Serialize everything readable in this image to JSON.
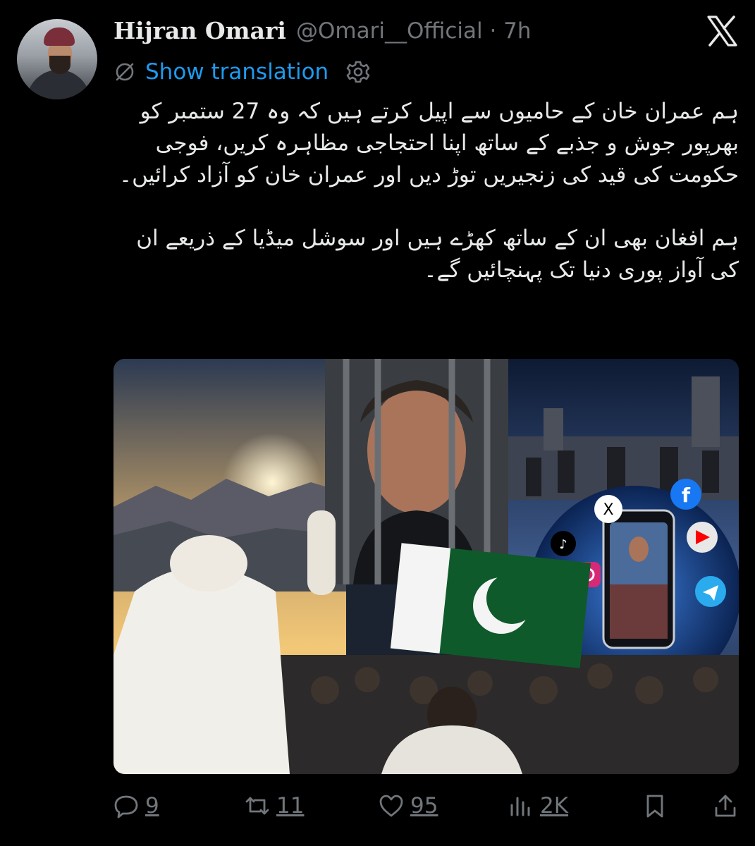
{
  "tweet": {
    "author_name": "Hijran Omari",
    "handle": "@Omari__Official",
    "separator": "·",
    "time": "7h",
    "show_translation": "Show translation",
    "text_paragraphs": [
      "ہم عمران خان کے حامیوں سے اپیل کرتے ہیں کہ وہ 27 ستمبر کو بھرپور جوش و جذبے کے ساتھ اپنا احتجاجی مظاہرہ کریں، فوجی حکومت کی قید کی زنجیریں توڑ دیں اور عمران خان کو آزاد کرائیں۔",
      "ہم افغان بھی ان کے ساتھ کھڑے ہیں اور سوشل میڈیا کے ذریعے ان کی آواز پوری دنیا تک پہنچائیں گے۔"
    ],
    "stats": {
      "replies": "9",
      "reposts": "11",
      "likes": "95",
      "views": "2K"
    }
  },
  "colors": {
    "background": "#000000",
    "text": "#e7e9ea",
    "muted": "#71767b",
    "link": "#1d9bf0"
  },
  "icons": [
    "x-logo-icon",
    "translate-globe-icon",
    "gear-icon",
    "reply-icon",
    "repost-icon",
    "like-icon",
    "views-icon",
    "bookmark-icon",
    "share-icon"
  ]
}
